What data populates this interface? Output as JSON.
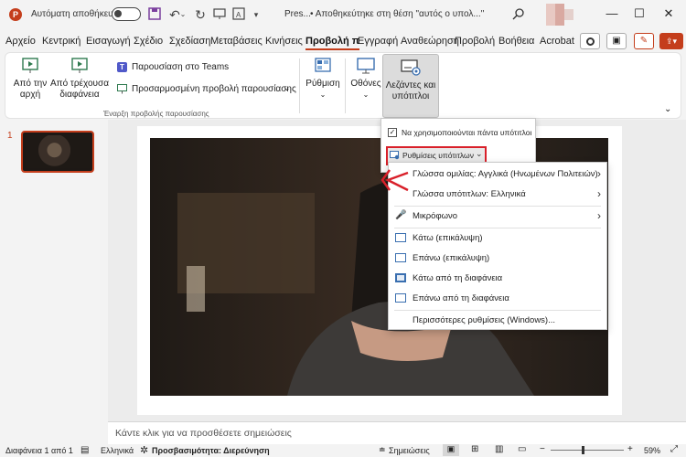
{
  "titlebar": {
    "autosave_label": "Αυτόματη αποθήκευση",
    "file_name": "Pres...",
    "status": "• Αποθηκεύτηκε στη θέση \"αυτός ο υπολ...\""
  },
  "menu_tabs": [
    "Αρχείο",
    "Κεντρική",
    "Εισαγωγή",
    "Σχέδιο",
    "Σχεδίαση",
    "Μεταβάσεις",
    "Κινήσεις",
    "Προβολή π",
    "Εγγραφή",
    "Αναθεώρηση",
    "Προβολή",
    "Βοήθεια",
    "Acrobat"
  ],
  "ribbon": {
    "from_start": [
      "Από την",
      "αρχή"
    ],
    "from_current": [
      "Από τρέχουσα",
      "διαφάνεια"
    ],
    "teams": "Παρουσίαση στο Teams",
    "custom_show": "Προσαρμοσμένη προβολή παρουσίασης",
    "group_start": "Έναρξη προβολής παρουσίασης",
    "setup": "Ρύθμιση",
    "monitors": "Οθόνες",
    "captions": [
      "Λεζάντες και",
      "υπότιτλοι"
    ]
  },
  "slide_pane": {
    "slide_number": "1"
  },
  "dropdown": {
    "always_use": "Να χρησιμοποιούνται πάντα υπότιτλοι",
    "subtitle_settings": "Ρυθμίσεις υπότιτλων"
  },
  "submenu": {
    "spoken_language": "Γλώσσα ομιλίας: Αγγλικά (Ηνωμένων Πολιτειών)",
    "subtitle_language": "Γλώσσα υπότιτλων: Ελληνικά",
    "microphone": "Μικρόφωνο",
    "bottom_overlay": "Κάτω (επικάλυψη)",
    "top_overlay": "Επάνω (επικάλυψη)",
    "below_slide": "Κάτω από τη διαφάνεια",
    "above_slide": "Επάνω από τη διαφάνεια",
    "more_settings": "Περισσότερες ρυθμίσεις (Windows)..."
  },
  "notes": {
    "placeholder": "Κάντε κλικ για να προσθέσετε σημειώσεις"
  },
  "status": {
    "slide_count": "Διαφάνεια 1 από 1",
    "language": "Ελληνικά",
    "accessibility": "Προσβασιμότητα: Διερεύνηση",
    "notes": "Σημειώσεις",
    "zoom": "59%"
  },
  "colors": {
    "accent": "#c43e1c",
    "highlight_box": "#d9202a",
    "icon_blue": "#3a6fb0"
  }
}
